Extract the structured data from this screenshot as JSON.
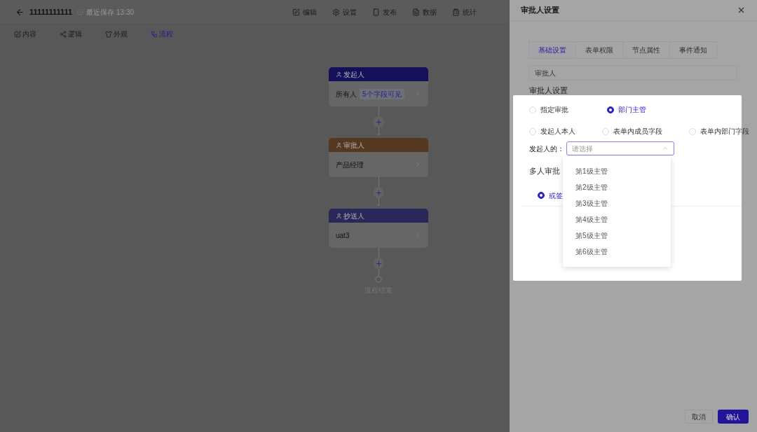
{
  "header": {
    "title": "11111111111",
    "save_status": "最近保存 13:30",
    "actions": [
      "编辑",
      "设置",
      "发布",
      "数据",
      "统计"
    ]
  },
  "subnav": [
    {
      "label": "内容",
      "selected": false
    },
    {
      "label": "逻辑",
      "selected": false
    },
    {
      "label": "外观",
      "selected": false
    },
    {
      "label": "流程",
      "selected": true
    }
  ],
  "flow": {
    "nodes": [
      {
        "title": "发起人",
        "color": "#15105a",
        "value": "所有人",
        "badge": "5个字段可见"
      },
      {
        "title": "审批人",
        "color": "#54381f",
        "value": "产品经理"
      },
      {
        "title": "抄送人",
        "color": "#2a2858",
        "value": "uat3"
      }
    ],
    "end": "流程结束"
  },
  "drawer": {
    "title": "审批人设置",
    "tabs": [
      {
        "label": "基础设置",
        "selected": true
      },
      {
        "label": "表单权限",
        "selected": false
      },
      {
        "label": "节点属性",
        "selected": false
      },
      {
        "label": "事件通知",
        "selected": false
      }
    ],
    "name_value": "审批人",
    "section": "审批人设置",
    "approver_types": [
      {
        "label": "指定审批",
        "selected": false
      },
      {
        "label": "部门主管",
        "selected": true
      },
      {
        "label": "发起人本人",
        "selected": false
      },
      {
        "label": "表单内成员字段",
        "selected": false
      },
      {
        "label": "表单内部门字段",
        "selected": false
      }
    ],
    "select": {
      "label": "发起人的：",
      "placeholder": "请选择",
      "expanded": true,
      "options": [
        "第1级主管",
        "第2级主管",
        "第3级主管",
        "第4级主管",
        "第5级主管",
        "第6级主管"
      ]
    },
    "multi_label": "多人审批",
    "multi_mode": {
      "label": "或签",
      "selected": true
    },
    "buttons": [
      "取消",
      "确认"
    ]
  }
}
